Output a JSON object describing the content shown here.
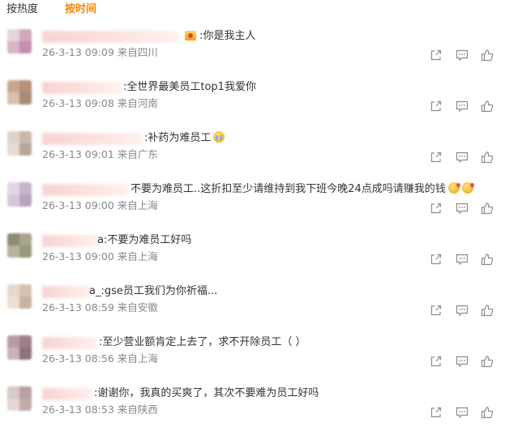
{
  "sort_tabs": {
    "hot": "按热度",
    "time": "按时间",
    "active": "time"
  },
  "colors": {
    "active_tab": "#ff8200",
    "meta_text": "#888888",
    "icon": "#8c8c8c"
  },
  "comments": [
    {
      "text": ":你是我主人",
      "emoji_before_text": "crown",
      "time": "26-3-13 09:09",
      "source": "来自四川"
    },
    {
      "text": ":全世界最美员工top1我爱你",
      "time": "26-3-13 09:08",
      "source": "来自河南"
    },
    {
      "text": ":补药为难员工",
      "emoji_after_text": "cry",
      "time": "26-3-13 09:01",
      "source": "来自广东"
    },
    {
      "text": "不要为难员工..这折扣至少请维持到我下班今晚24点成吗请赚我的钱",
      "emoji_after_text": "kiss x2",
      "time": "26-3-13 09:00",
      "source": "来自上海"
    },
    {
      "text": "a:不要为难员工好吗",
      "time": "26-3-13 09:00",
      "source": "来自上海"
    },
    {
      "text": "a_:gse员工我们为你祈福...",
      "time": "26-3-13 08:59",
      "source": "来自安徽"
    },
    {
      "text": ":至少营业额肯定上去了，求不开除员工（ ）",
      "time": "26-3-13 08:56",
      "source": "来自上海"
    },
    {
      "text": ":谢谢你，我真的买爽了，其次不要难为员工好吗",
      "time": "26-3-13 08:53",
      "source": "来自陕西"
    }
  ],
  "action_icons": [
    "share-icon",
    "comment-icon",
    "like-icon"
  ]
}
